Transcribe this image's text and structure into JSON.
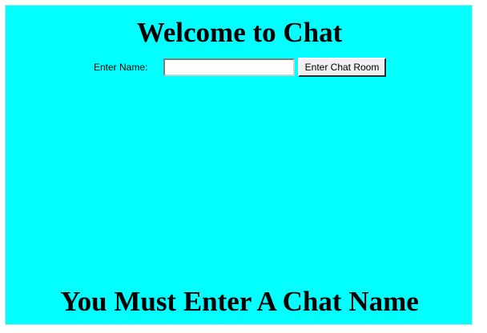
{
  "page": {
    "title": "Welcome to Chat",
    "background_color": "#00ffff"
  },
  "login_form": {
    "name_label": "Enter Name:",
    "name_value": "",
    "name_placeholder": "",
    "submit_label": "Enter Chat Room"
  },
  "message": {
    "warning": "You Must Enter A Chat Name"
  }
}
